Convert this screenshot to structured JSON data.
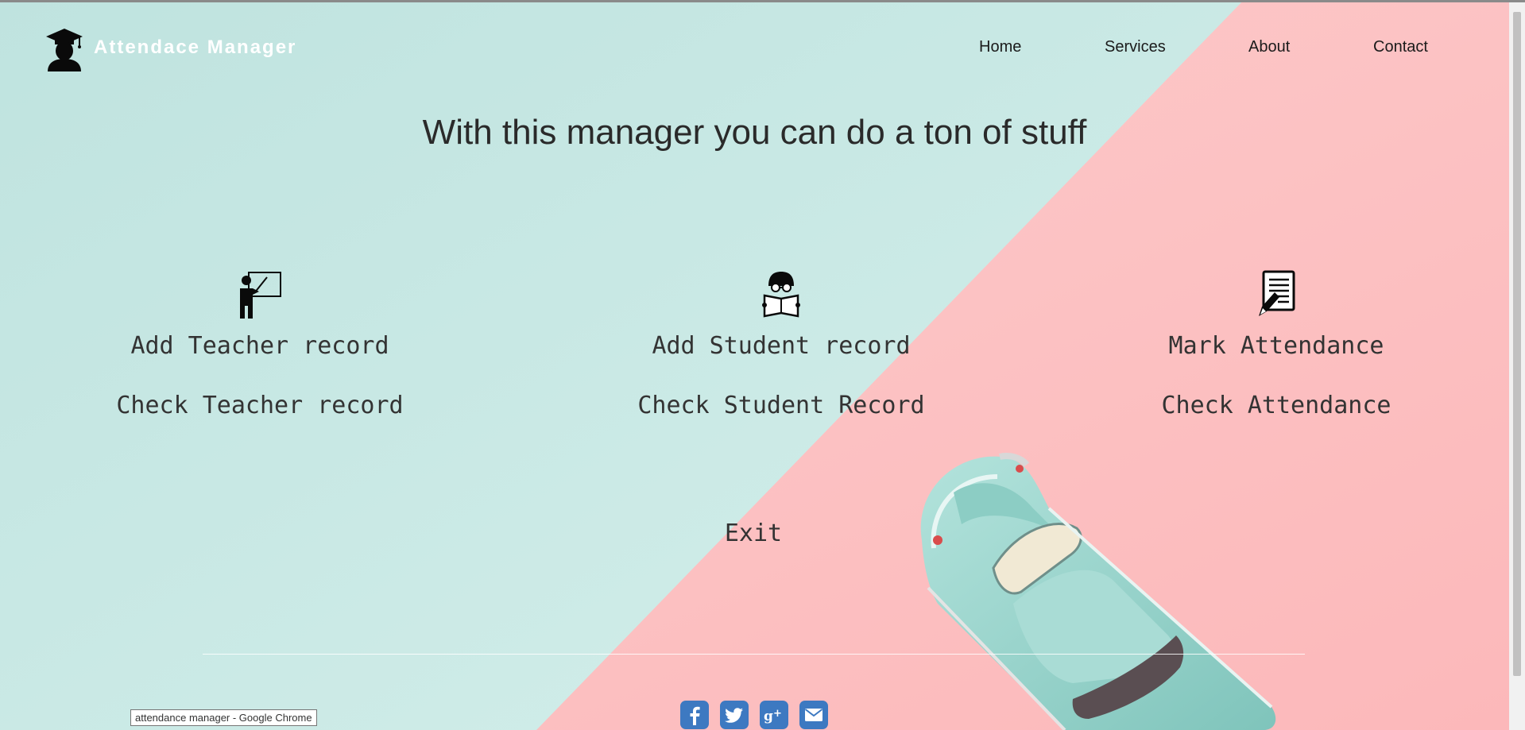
{
  "header": {
    "brand": "Attendace Manager",
    "nav": [
      "Home",
      "Services",
      "About",
      "Contact"
    ]
  },
  "main": {
    "headline": "With this manager you can do a ton of stuff",
    "teacher": {
      "icon": "teacher-icon",
      "add_label": "Add Teacher record",
      "check_label": "Check Teacher record"
    },
    "student": {
      "icon": "student-reading-icon",
      "add_label": "Add Student record",
      "check_label": "Check Student Record"
    },
    "attendance": {
      "icon": "attendance-sheet-icon",
      "mark_label": "Mark Attendance",
      "check_label": "Check Attendance"
    },
    "exit_label": "Exit"
  },
  "footer": {
    "social": [
      "facebook-icon",
      "twitter-icon",
      "google-plus-icon",
      "mail-icon"
    ]
  },
  "tooltip": "attendance manager - Google Chrome",
  "colors": {
    "mint": "#c6e8e3",
    "pink": "#fdc1c3",
    "social_blue": "#3d79c1",
    "car_teal": "#9fd6cf"
  }
}
